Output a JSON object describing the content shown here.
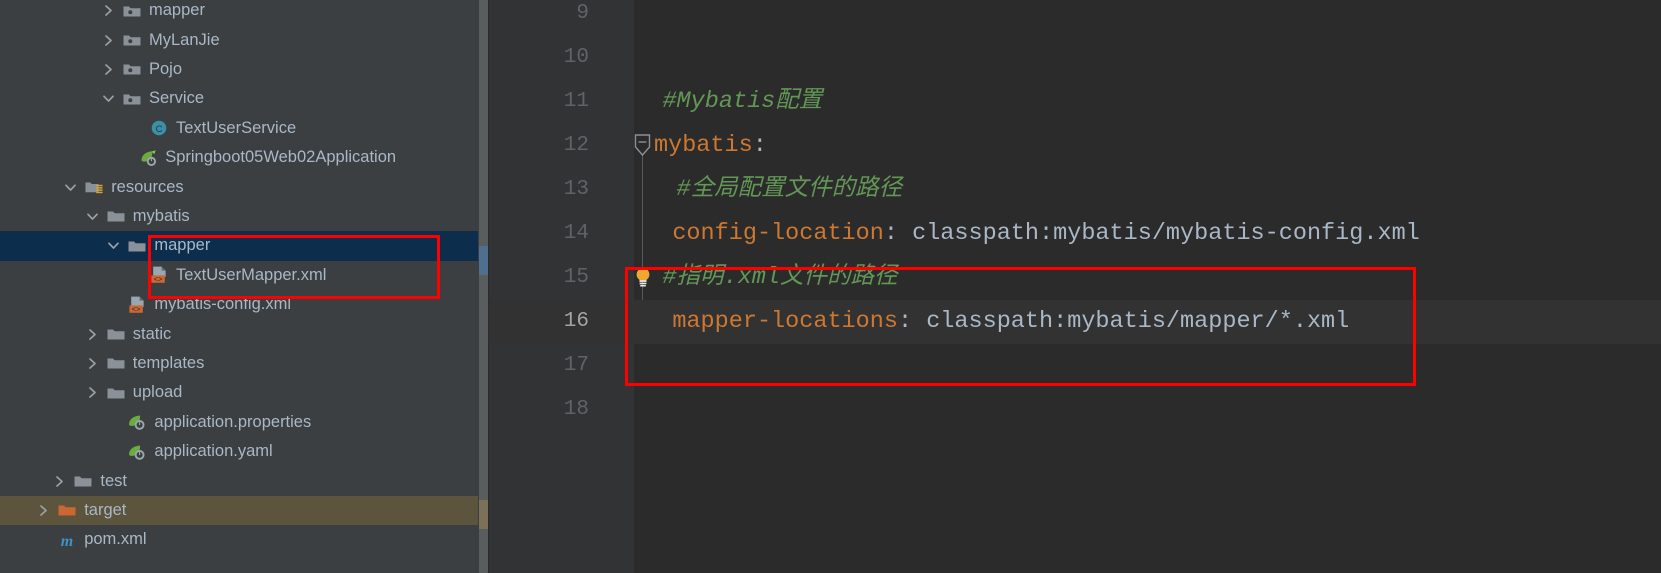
{
  "sidebar": {
    "name": "project-tree",
    "scroll": {
      "name": "vertical-scrollbar"
    },
    "items": [
      {
        "label": "mapper",
        "indent": 3,
        "arrow": "chevron-right",
        "icon": "package-folder-icon",
        "state": "normal"
      },
      {
        "label": "MyLanJie",
        "indent": 3,
        "arrow": "chevron-right",
        "icon": "package-folder-icon",
        "state": "normal"
      },
      {
        "label": "Pojo",
        "indent": 3,
        "arrow": "chevron-right",
        "icon": "package-folder-icon",
        "state": "normal"
      },
      {
        "label": "Service",
        "indent": 3,
        "arrow": "chevron-down",
        "icon": "package-folder-icon",
        "state": "normal"
      },
      {
        "label": "TextUserService",
        "indent": 4,
        "arrow": "none",
        "icon": "java-class-icon",
        "state": "normal"
      },
      {
        "label": "Springboot05Web02Application",
        "indent": 3.6,
        "arrow": "none",
        "icon": "spring-boot-app-icon",
        "state": "normal"
      },
      {
        "label": "resources",
        "indent": 1.6,
        "arrow": "chevron-down",
        "icon": "resources-folder-icon",
        "state": "normal"
      },
      {
        "label": "mybatis",
        "indent": 2.4,
        "arrow": "chevron-down",
        "icon": "folder-icon",
        "state": "normal"
      },
      {
        "label": "mapper",
        "indent": 3.2,
        "arrow": "chevron-down",
        "icon": "folder-icon",
        "state": "selected"
      },
      {
        "label": "TextUserMapper.xml",
        "indent": 4,
        "arrow": "none",
        "icon": "xml-file-icon",
        "state": "normal"
      },
      {
        "label": "mybatis-config.xml",
        "indent": 3.2,
        "arrow": "none",
        "icon": "xml-file-icon",
        "state": "normal"
      },
      {
        "label": "static",
        "indent": 2.4,
        "arrow": "chevron-right",
        "icon": "folder-icon",
        "state": "normal"
      },
      {
        "label": "templates",
        "indent": 2.4,
        "arrow": "chevron-right",
        "icon": "folder-icon",
        "state": "normal"
      },
      {
        "label": "upload",
        "indent": 2.4,
        "arrow": "chevron-right",
        "icon": "folder-icon",
        "state": "normal"
      },
      {
        "label": "application.properties",
        "indent": 3.2,
        "arrow": "none",
        "icon": "spring-config-icon",
        "state": "normal"
      },
      {
        "label": "application.yaml",
        "indent": 3.2,
        "arrow": "none",
        "icon": "spring-config-icon",
        "state": "normal"
      },
      {
        "label": "test",
        "indent": 1.2,
        "arrow": "chevron-right",
        "icon": "folder-icon",
        "state": "normal"
      },
      {
        "label": "target",
        "indent": 0.6,
        "arrow": "chevron-right",
        "icon": "excluded-folder-icon",
        "state": "target"
      },
      {
        "label": "pom.xml",
        "indent": 0.6,
        "arrow": "none",
        "icon": "maven-icon",
        "state": "normal"
      }
    ]
  },
  "editor": {
    "name": "yaml-editor",
    "current_line": 16,
    "gutter": {
      "line_numbers": [
        "9",
        "10",
        "11",
        "12",
        "13",
        "14",
        "15",
        "16",
        "17",
        "18"
      ]
    },
    "lines": [
      {
        "number": "9",
        "indent": 0,
        "segments": []
      },
      {
        "number": "10",
        "indent": 0,
        "segments": []
      },
      {
        "number": "11",
        "indent": 0.6,
        "segments": [
          {
            "text": "#Mybatis配置",
            "type": "cmt"
          }
        ]
      },
      {
        "number": "12",
        "indent": 0,
        "segments": [
          {
            "text": "mybatis",
            "type": "key"
          },
          {
            "text": ":",
            "type": "punc"
          }
        ]
      },
      {
        "number": "13",
        "indent": 1.6,
        "segments": [
          {
            "text": "#全局配置文件的路径",
            "type": "cmt"
          }
        ]
      },
      {
        "number": "14",
        "indent": 1.3,
        "segments": [
          {
            "text": "config-location",
            "type": "key"
          },
          {
            "text": ": ",
            "type": "punc"
          },
          {
            "text": "classpath:mybatis/mybatis-config.xml",
            "type": "val"
          }
        ]
      },
      {
        "number": "15",
        "indent": 0.6,
        "segments": [
          {
            "text": "#指明.xml文件的路径",
            "type": "cmt"
          }
        ]
      },
      {
        "number": "16",
        "indent": 1.3,
        "segments": [
          {
            "text": "mapper-locations",
            "type": "key"
          },
          {
            "text": ": ",
            "type": "punc"
          },
          {
            "text": "classpath:mybatis/mapper/*.xml",
            "type": "val"
          }
        ]
      },
      {
        "number": "17",
        "indent": 0,
        "segments": []
      },
      {
        "number": "18",
        "indent": 0,
        "segments": []
      }
    ],
    "fold_markers": [
      {
        "name": "fold-marker-expanded-mybatis",
        "line": "12",
        "kind": "expanded"
      },
      {
        "name": "fold-marker-collapsed-line16",
        "line": "16",
        "kind": "end"
      }
    ],
    "intention_bulb": {
      "name": "intention-bulb-icon",
      "line": "15"
    }
  },
  "annotations": {
    "name": "red-highlight-boxes",
    "boxes": [
      {
        "name": "highlight-mapper-folder",
        "target": "sidebar mapper folder and TextUserMapper.xml"
      },
      {
        "name": "highlight-mapper-locations",
        "target": "editor lines 15-16 mapper-locations"
      }
    ]
  },
  "colors": {
    "accent_red": "#ff0000",
    "selection_blue": "#0d2d4d",
    "target_olive": "#5c543c",
    "comment_green": "#629755",
    "key_orange": "#cc7832",
    "text_gray": "#a9b7c6",
    "editor_bg": "#2b2b2b",
    "sidebar_bg": "#3c3f41"
  }
}
